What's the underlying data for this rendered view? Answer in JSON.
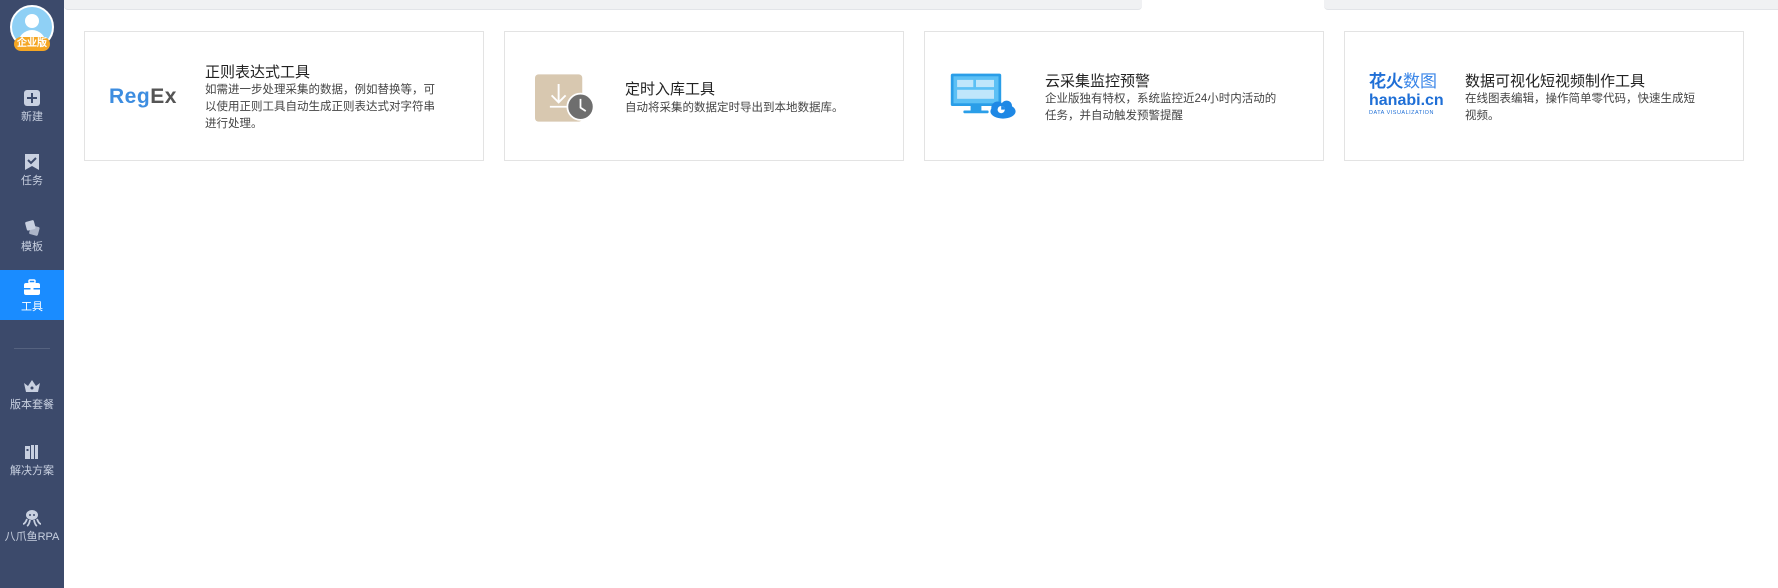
{
  "sidebar": {
    "avatar_badge": "企业版",
    "items": [
      {
        "label": "新建",
        "icon": "plus-square-icon"
      },
      {
        "label": "任务",
        "icon": "bookmark-check-icon"
      },
      {
        "label": "模板",
        "icon": "template-tiles-icon"
      },
      {
        "label": "工具",
        "icon": "toolbox-icon",
        "active": true
      },
      {
        "label": "版本套餐",
        "icon": "crown-icon"
      },
      {
        "label": "解决方案",
        "icon": "book-columns-icon"
      },
      {
        "label": "八爪鱼RPA",
        "icon": "octopus-icon"
      }
    ],
    "active_color": "#1a8cff",
    "background_color": "#3c4a6b"
  },
  "tools": [
    {
      "logo_text_a": "Reg",
      "logo_text_b": "Ex",
      "title": "正则表达式工具",
      "desc": "如需进一步处理采集的数据，例如替换等，可以使用正则工具自动生成正则表达式对字符串进行处理。"
    },
    {
      "logo_icon": "download-clock-icon",
      "title": "定时入库工具",
      "desc": "自动将采集的数据定时导出到本地数据库。"
    },
    {
      "logo_icon": "monitor-cloud-icon",
      "title": "云采集监控预警",
      "desc": "企业版独有特权，系统监控近24小时内活动的任务，并自动触发预警提醒"
    },
    {
      "logo_text_a": "花火",
      "logo_text_b": "数图",
      "logo_text_c": "hanabi.cn",
      "logo_text_d": "DATA VISUALIZATION",
      "title": "数据可视化短视频制作工具",
      "desc": "在线图表编辑，操作简单零代码，快速生成短视频。"
    }
  ]
}
